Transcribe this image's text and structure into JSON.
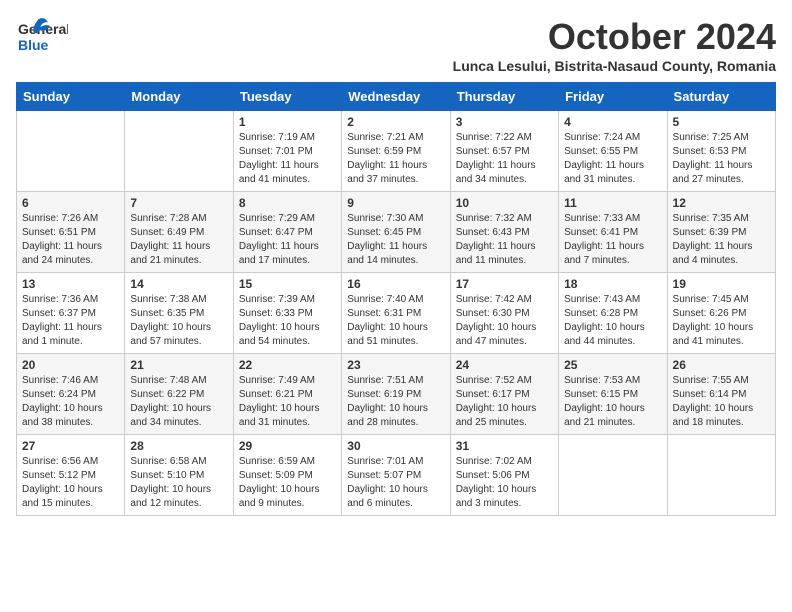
{
  "header": {
    "logo_general": "General",
    "logo_blue": "Blue",
    "month_title": "October 2024",
    "subtitle": "Lunca Lesului, Bistrita-Nasaud County, Romania"
  },
  "calendar": {
    "days_of_week": [
      "Sunday",
      "Monday",
      "Tuesday",
      "Wednesday",
      "Thursday",
      "Friday",
      "Saturday"
    ],
    "weeks": [
      [
        {
          "day": "",
          "info": ""
        },
        {
          "day": "",
          "info": ""
        },
        {
          "day": "1",
          "info": "Sunrise: 7:19 AM\nSunset: 7:01 PM\nDaylight: 11 hours and 41 minutes."
        },
        {
          "day": "2",
          "info": "Sunrise: 7:21 AM\nSunset: 6:59 PM\nDaylight: 11 hours and 37 minutes."
        },
        {
          "day": "3",
          "info": "Sunrise: 7:22 AM\nSunset: 6:57 PM\nDaylight: 11 hours and 34 minutes."
        },
        {
          "day": "4",
          "info": "Sunrise: 7:24 AM\nSunset: 6:55 PM\nDaylight: 11 hours and 31 minutes."
        },
        {
          "day": "5",
          "info": "Sunrise: 7:25 AM\nSunset: 6:53 PM\nDaylight: 11 hours and 27 minutes."
        }
      ],
      [
        {
          "day": "6",
          "info": "Sunrise: 7:26 AM\nSunset: 6:51 PM\nDaylight: 11 hours and 24 minutes."
        },
        {
          "day": "7",
          "info": "Sunrise: 7:28 AM\nSunset: 6:49 PM\nDaylight: 11 hours and 21 minutes."
        },
        {
          "day": "8",
          "info": "Sunrise: 7:29 AM\nSunset: 6:47 PM\nDaylight: 11 hours and 17 minutes."
        },
        {
          "day": "9",
          "info": "Sunrise: 7:30 AM\nSunset: 6:45 PM\nDaylight: 11 hours and 14 minutes."
        },
        {
          "day": "10",
          "info": "Sunrise: 7:32 AM\nSunset: 6:43 PM\nDaylight: 11 hours and 11 minutes."
        },
        {
          "day": "11",
          "info": "Sunrise: 7:33 AM\nSunset: 6:41 PM\nDaylight: 11 hours and 7 minutes."
        },
        {
          "day": "12",
          "info": "Sunrise: 7:35 AM\nSunset: 6:39 PM\nDaylight: 11 hours and 4 minutes."
        }
      ],
      [
        {
          "day": "13",
          "info": "Sunrise: 7:36 AM\nSunset: 6:37 PM\nDaylight: 11 hours and 1 minute."
        },
        {
          "day": "14",
          "info": "Sunrise: 7:38 AM\nSunset: 6:35 PM\nDaylight: 10 hours and 57 minutes."
        },
        {
          "day": "15",
          "info": "Sunrise: 7:39 AM\nSunset: 6:33 PM\nDaylight: 10 hours and 54 minutes."
        },
        {
          "day": "16",
          "info": "Sunrise: 7:40 AM\nSunset: 6:31 PM\nDaylight: 10 hours and 51 minutes."
        },
        {
          "day": "17",
          "info": "Sunrise: 7:42 AM\nSunset: 6:30 PM\nDaylight: 10 hours and 47 minutes."
        },
        {
          "day": "18",
          "info": "Sunrise: 7:43 AM\nSunset: 6:28 PM\nDaylight: 10 hours and 44 minutes."
        },
        {
          "day": "19",
          "info": "Sunrise: 7:45 AM\nSunset: 6:26 PM\nDaylight: 10 hours and 41 minutes."
        }
      ],
      [
        {
          "day": "20",
          "info": "Sunrise: 7:46 AM\nSunset: 6:24 PM\nDaylight: 10 hours and 38 minutes."
        },
        {
          "day": "21",
          "info": "Sunrise: 7:48 AM\nSunset: 6:22 PM\nDaylight: 10 hours and 34 minutes."
        },
        {
          "day": "22",
          "info": "Sunrise: 7:49 AM\nSunset: 6:21 PM\nDaylight: 10 hours and 31 minutes."
        },
        {
          "day": "23",
          "info": "Sunrise: 7:51 AM\nSunset: 6:19 PM\nDaylight: 10 hours and 28 minutes."
        },
        {
          "day": "24",
          "info": "Sunrise: 7:52 AM\nSunset: 6:17 PM\nDaylight: 10 hours and 25 minutes."
        },
        {
          "day": "25",
          "info": "Sunrise: 7:53 AM\nSunset: 6:15 PM\nDaylight: 10 hours and 21 minutes."
        },
        {
          "day": "26",
          "info": "Sunrise: 7:55 AM\nSunset: 6:14 PM\nDaylight: 10 hours and 18 minutes."
        }
      ],
      [
        {
          "day": "27",
          "info": "Sunrise: 6:56 AM\nSunset: 5:12 PM\nDaylight: 10 hours and 15 minutes."
        },
        {
          "day": "28",
          "info": "Sunrise: 6:58 AM\nSunset: 5:10 PM\nDaylight: 10 hours and 12 minutes."
        },
        {
          "day": "29",
          "info": "Sunrise: 6:59 AM\nSunset: 5:09 PM\nDaylight: 10 hours and 9 minutes."
        },
        {
          "day": "30",
          "info": "Sunrise: 7:01 AM\nSunset: 5:07 PM\nDaylight: 10 hours and 6 minutes."
        },
        {
          "day": "31",
          "info": "Sunrise: 7:02 AM\nSunset: 5:06 PM\nDaylight: 10 hours and 3 minutes."
        },
        {
          "day": "",
          "info": ""
        },
        {
          "day": "",
          "info": ""
        }
      ]
    ]
  }
}
